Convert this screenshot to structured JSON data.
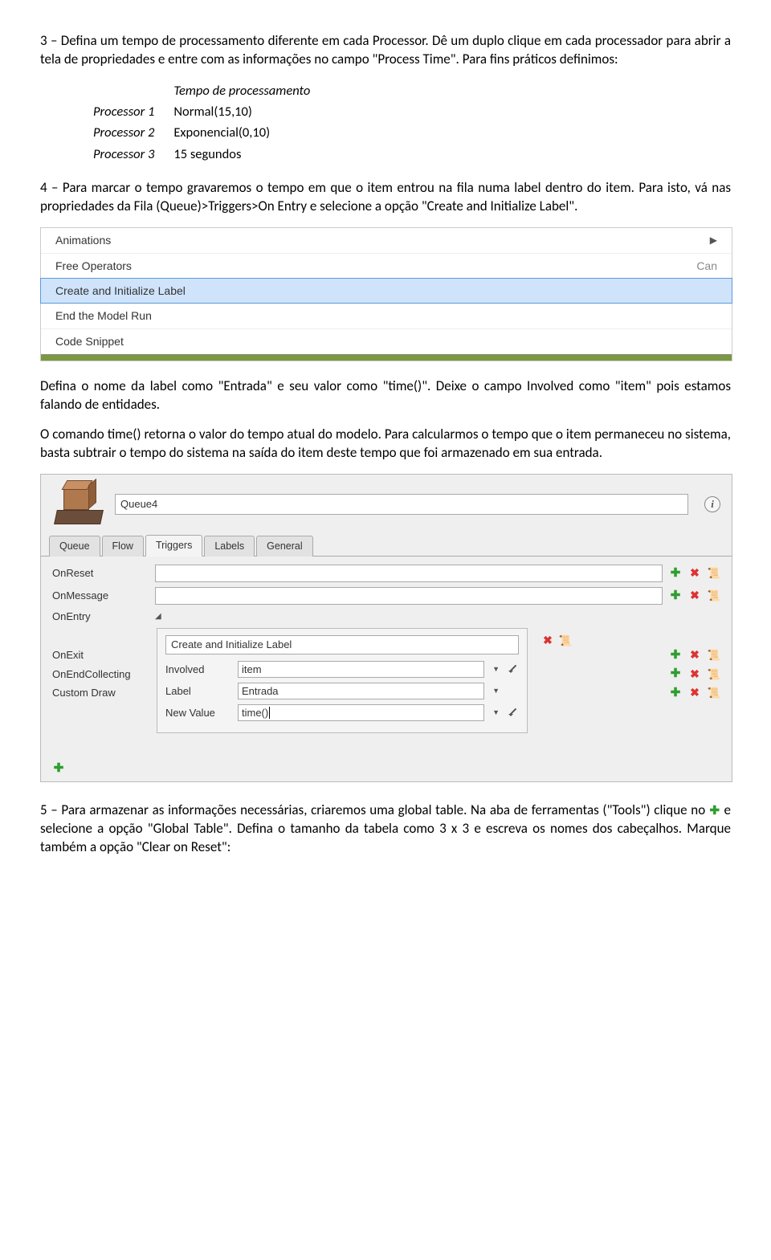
{
  "para1": "3 – Defina um tempo de processamento diferente em cada Processor. Dê um duplo clique em cada processador para abrir a tela de propriedades e entre com as informações no campo \"Process Time\". Para fins práticos definimos:",
  "times": {
    "header": "Tempo de processamento",
    "rows": [
      {
        "label": "Processor 1",
        "value": "Normal(15,10)"
      },
      {
        "label": "Processor 2",
        "value": "Exponencial(0,10)"
      },
      {
        "label": "Processor 3",
        "value": "15 segundos"
      }
    ]
  },
  "para2": "4 – Para marcar o tempo gravaremos o tempo em que o item entrou na fila numa label dentro do item. Para isto, vá nas propriedades da Fila (Queue)>Triggers>On Entry e selecione a opção \"Create and Initialize Label\".",
  "shot1": {
    "items": [
      "Animations",
      "Free Operators",
      "Create and Initialize Label",
      "End the Model Run",
      "Code Snippet"
    ],
    "selected": 2,
    "rightTextTop": "Can"
  },
  "para3": "Defina o nome da label como \"Entrada\" e seu valor como \"time()\". Deixe o campo Involved como \"item\" pois estamos falando de entidades.",
  "para4": "O comando time() retorna o valor do tempo atual do modelo. Para calcularmos o tempo que o item permaneceu no sistema, basta subtrair o tempo do sistema na saída do item deste tempo que foi armazenado em sua entrada.",
  "shot2": {
    "objectName": "Queue4",
    "tabs": [
      "Queue",
      "Flow",
      "Triggers",
      "Labels",
      "General"
    ],
    "activeTab": 2,
    "triggers": [
      "OnReset",
      "OnMessage",
      "OnEntry",
      "OnExit",
      "OnEndCollecting",
      "Custom Draw"
    ],
    "panel": {
      "title": "Create and Initialize Label",
      "involvedLabel": "Involved",
      "involvedValue": "item",
      "labelLabel": "Label",
      "labelValue": "Entrada",
      "newValueLabel": "New Value",
      "newValueValue": "time()"
    }
  },
  "para5a": "5 – Para armazenar as informações necessárias, criaremos uma global table. Na aba de ferramentas (\"Tools\") clique no ",
  "para5b": " e selecione a opção \"Global Table\". Defina o tamanho da tabela como 3 x 3 e escreva os nomes dos cabeçalhos. Marque também a opção \"Clear on Reset\":"
}
